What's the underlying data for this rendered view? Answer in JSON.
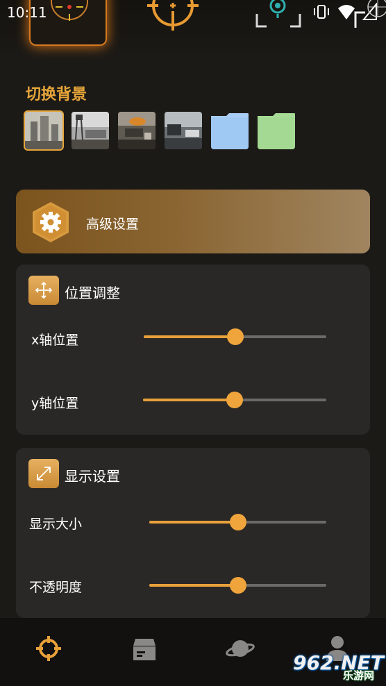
{
  "status_bar": {
    "time": "10:11",
    "icons": [
      "vibrate-icon",
      "wifi-icon",
      "signal-icon"
    ]
  },
  "background_section": {
    "title": "切换背景",
    "thumbnails": [
      {
        "name": "ruined-city-thumbnail",
        "selected": true
      },
      {
        "name": "watchtower-thumbnail",
        "selected": false
      },
      {
        "name": "battle-thumbnail",
        "selected": false
      },
      {
        "name": "battlefield-thumbnail",
        "selected": false
      },
      {
        "name": "blue-folder-thumbnail",
        "selected": false,
        "color": "#a9cdf5"
      },
      {
        "name": "green-folder-thumbnail",
        "selected": false,
        "color": "#a6dc96"
      }
    ]
  },
  "advanced": {
    "label": "高级设置"
  },
  "position_panel": {
    "title": "位置调整",
    "rows": [
      {
        "label": "x轴位置",
        "value": 0.5
      },
      {
        "label": "y轴位置",
        "value": 0.5
      }
    ]
  },
  "display_panel": {
    "title": "显示设置",
    "rows": [
      {
        "label": "显示大小",
        "value": 0.5
      },
      {
        "label": "不透明度",
        "value": 0.5
      }
    ]
  },
  "bottom_nav": {
    "items": [
      "crosshair-icon",
      "box-icon",
      "planet-icon",
      "person-icon"
    ],
    "active": "crosshair-icon"
  },
  "watermark": {
    "big": "962.NET",
    "small": "乐游网"
  },
  "colors": {
    "accent": "#e8a03a",
    "background": "#1c1a17",
    "panel": "#2a2826"
  }
}
